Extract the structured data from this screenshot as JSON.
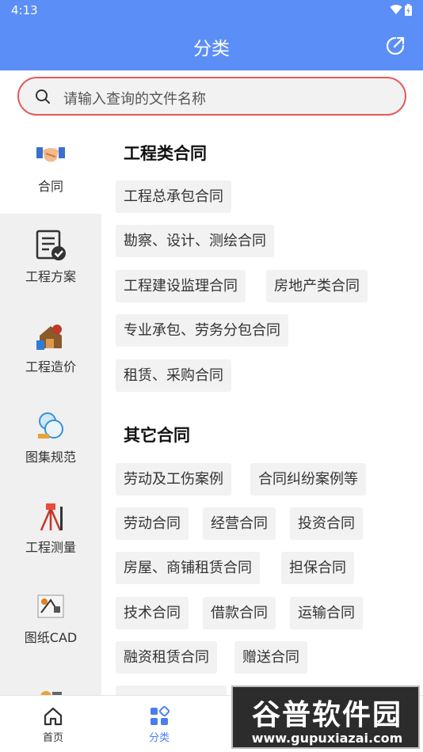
{
  "status_bar": {
    "time": "4:13"
  },
  "header": {
    "title": "分类",
    "share_icon": "share-icon"
  },
  "search": {
    "placeholder": "请输入查询的文件名称"
  },
  "sidebar": {
    "items": [
      {
        "label": "合同",
        "icon": "handshake-icon",
        "active": true
      },
      {
        "label": "工程方案",
        "icon": "document-check-icon"
      },
      {
        "label": "工程造价",
        "icon": "house-calculator-icon"
      },
      {
        "label": "图集规范",
        "icon": "atlas-icon"
      },
      {
        "label": "工程测量",
        "icon": "survey-tripod-icon"
      },
      {
        "label": "图纸CAD",
        "icon": "drawing-tools-icon"
      },
      {
        "label": "",
        "icon": "tools-icon"
      }
    ]
  },
  "content": {
    "sections": [
      {
        "title": "工程类合同",
        "chips": [
          "工程总承包合同",
          "勘察、设计、测绘合同",
          "工程建设监理合同",
          "房地产类合同",
          "专业承包、劳务分包合同",
          "租赁、采购合同"
        ]
      },
      {
        "title": "其它合同",
        "chips": [
          "劳动及工伤案例",
          "合同纠纷案例等",
          "劳动合同",
          "经营合同",
          "投资合同",
          "房屋、商铺租赁合同",
          "担保合同",
          "技术合同",
          "借款合同",
          "运输合同",
          "融资租赁合同",
          "赠送合同"
        ]
      }
    ]
  },
  "bottom_nav": {
    "tabs": [
      {
        "label": "首页",
        "icon": "home-icon"
      },
      {
        "label": "分类",
        "icon": "category-icon",
        "active": true
      }
    ]
  },
  "watermark": {
    "main": "谷普软件园",
    "url": "www.gupuxiazai.com"
  },
  "colors": {
    "primary": "#5b8ef7",
    "search_border": "#e45a5a",
    "chip_bg": "#f2f2f2",
    "sidebar_bg": "#f0f0f0",
    "active_tab": "#4c7df0"
  }
}
